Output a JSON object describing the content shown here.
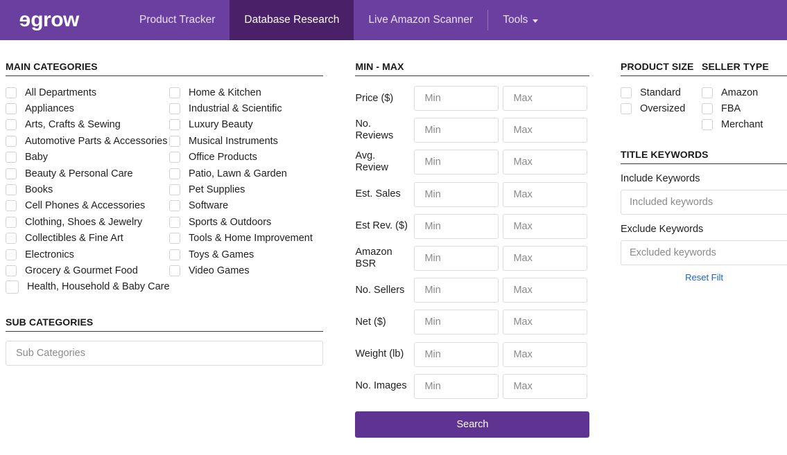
{
  "header": {
    "brand": "egrow",
    "brand_first_letter": "e",
    "brand_rest": "grow",
    "nav": [
      {
        "label": "Product Tracker",
        "active": false
      },
      {
        "label": "Database Research",
        "active": true
      },
      {
        "label": "Live Amazon Scanner",
        "active": false
      },
      {
        "label": "Tools",
        "active": false,
        "has_caret": true
      }
    ],
    "colors": {
      "bar": "#6b3fa0",
      "active_tab": "#4a2068",
      "text": "#ffffff"
    }
  },
  "main_categories": {
    "title": "MAIN CATEGORIES",
    "left_column": [
      "All Departments",
      "Appliances",
      "Arts, Crafts & Sewing",
      "Automotive Parts & Accessories",
      "Baby",
      "Beauty & Personal Care",
      "Books",
      "Cell Phones & Accessories",
      "Clothing, Shoes & Jewelry",
      "Collectibles & Fine Art",
      "Electronics",
      "Grocery & Gourmet Food",
      "Health, Household & Baby Care"
    ],
    "right_column": [
      "Home & Kitchen",
      "Industrial & Scientific",
      "Luxury Beauty",
      "Musical Instruments",
      "Office Products",
      "Patio, Lawn & Garden",
      "Pet Supplies",
      "Software",
      "Sports & Outdoors",
      "Tools & Home Improvement",
      "Toys & Games",
      "Video Games"
    ]
  },
  "sub_categories": {
    "title": "SUB CATEGORIES",
    "placeholder": "Sub Categories",
    "value": ""
  },
  "min_max": {
    "title": "MIN - MAX",
    "min_placeholder": "Min",
    "max_placeholder": "Max",
    "rows": [
      {
        "label": "Price ($)",
        "min": "",
        "max": ""
      },
      {
        "label": "No. Reviews",
        "min": "",
        "max": ""
      },
      {
        "label": "Avg. Review",
        "min": "",
        "max": ""
      },
      {
        "label": "Est. Sales",
        "min": "",
        "max": ""
      },
      {
        "label": "Est Rev. ($)",
        "min": "",
        "max": ""
      },
      {
        "label": "Amazon BSR",
        "min": "",
        "max": ""
      },
      {
        "label": "No. Sellers",
        "min": "",
        "max": ""
      },
      {
        "label": "Net ($)",
        "min": "",
        "max": ""
      },
      {
        "label": "Weight (lb)",
        "min": "",
        "max": ""
      },
      {
        "label": "No. Images",
        "min": "",
        "max": ""
      }
    ],
    "search_label": "Search",
    "search_color": "#5f3391"
  },
  "product_size": {
    "title": "PRODUCT SIZE",
    "options": [
      "Standard",
      "Oversized"
    ]
  },
  "seller_type": {
    "title": "SELLER TYPE",
    "options": [
      "Amazon",
      "FBA",
      "Merchant"
    ]
  },
  "title_keywords": {
    "title": "TITLE KEYWORDS",
    "include_label": "Include Keywords",
    "include_placeholder": "Included keywords",
    "include_value": "",
    "exclude_label": "Exclude Keywords",
    "exclude_placeholder": "Excluded keywords",
    "exclude_value": "",
    "reset_label": "Reset Filt",
    "reset_color": "#1a63c4"
  }
}
